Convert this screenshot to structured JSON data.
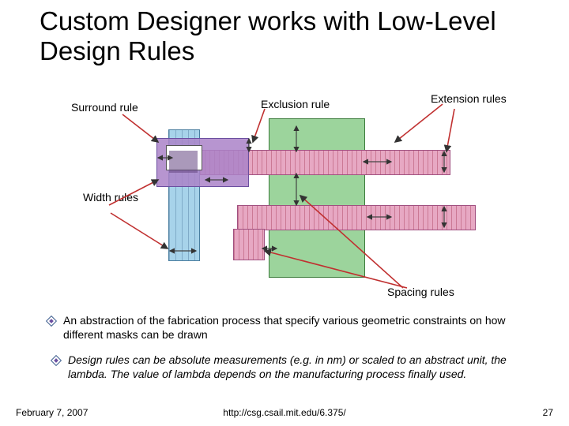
{
  "title": "Custom Designer works with Low-Level Design Rules",
  "labels": {
    "surround": "Surround rule",
    "exclusion": "Exclusion rule",
    "extension": "Extension rules",
    "width": "Width rules",
    "spacing": "Spacing rules"
  },
  "bullets": [
    "An abstraction of the fabrication process that specify various geometric constraints on how different masks can be drawn",
    "Design rules can be absolute measurements (e.g. in nm) or scaled to an abstract unit, the lambda. The value of lambda depends on the manufacturing process finally used."
  ],
  "footer": {
    "date": "February 7, 2007",
    "url": "http://csg.csail.mit.edu/6.375/",
    "page": "27"
  }
}
